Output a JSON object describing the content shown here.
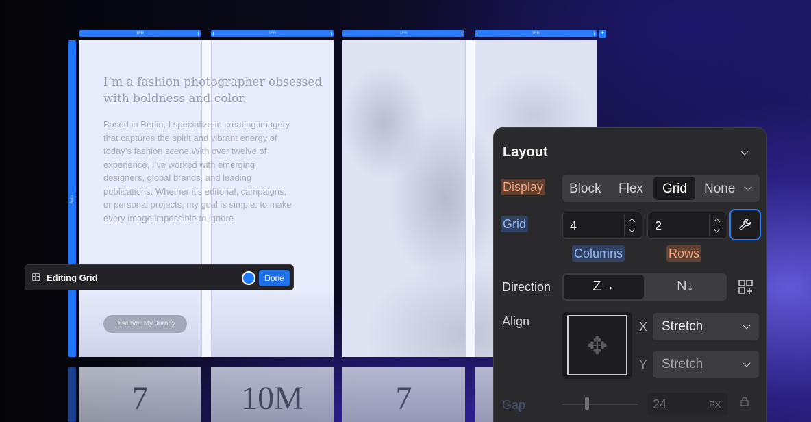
{
  "grid_editor": {
    "column_tracks": [
      "1FR",
      "1FR",
      "1FR",
      "1FR"
    ],
    "add_column": "+",
    "row_track": "Auto"
  },
  "page": {
    "headline": "I’m a fashion photographer obsessed with boldness and color.",
    "body": "Based in Berlin, I specialize in creating imagery\nthat captures the spirit and vibrant energy of\ntoday’s fashion scene.With over twelve of\nexperience, I’ve worked with emerging\ndesigners, global brands, and leading\npublications. Whether it’s editorial, campaigns,\nor personal projects, my goal is simple: to make\nevery image impossible to ignore.",
    "cta": "Discover My Jurney",
    "stats": [
      "7",
      "10M",
      "7"
    ]
  },
  "edit_toolbar": {
    "title": "Editing Grid",
    "done": "Done"
  },
  "layout_panel": {
    "title": "Layout",
    "display_label": "Display",
    "display_options": [
      "Block",
      "Flex",
      "Grid",
      "None"
    ],
    "display_selected": "Grid",
    "grid_label": "Grid",
    "columns_value": "4",
    "rows_value": "2",
    "columns_label": "Columns",
    "rows_label": "Rows",
    "direction_label": "Direction",
    "direction_row_glyph": "Z→",
    "direction_col_glyph": "N↓",
    "align_label": "Align",
    "align_x_label": "X",
    "align_y_label": "Y",
    "align_x_value": "Stretch",
    "align_y_value": "Stretch",
    "gap_label": "Gap",
    "gap_value": "24",
    "gap_unit": "PX"
  },
  "colors": {
    "accent": "#2a7bff",
    "panel_bg": "#2a2a2d",
    "highlight_orange": "#f0a27c",
    "highlight_blue": "#8fb6ee"
  }
}
